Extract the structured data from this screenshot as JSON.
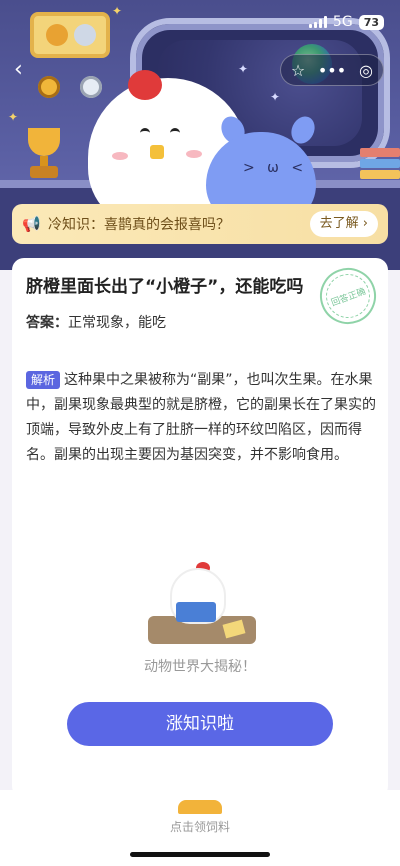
{
  "status_bar": {
    "network": "5G",
    "battery": "73"
  },
  "header": {
    "back_icon": "chevron-left-icon",
    "actions": [
      {
        "name": "favorite",
        "icon": "star-outline-icon"
      },
      {
        "name": "more",
        "icon": "more-dots-icon"
      },
      {
        "name": "close",
        "icon": "target-circle-icon"
      }
    ]
  },
  "tip": {
    "icon": "megaphone-icon",
    "text": "冷知识：喜鹊真的会报喜吗？",
    "button_label": "去了解 ›"
  },
  "question": {
    "title": "脐橙里面长出了“小橙子”，还能吃吗",
    "answer_label": "答案：",
    "answer_value": "正常现象，能吃",
    "stamp_text": "回答正确",
    "analysis_tag": "解析",
    "analysis_text": "这种果中之果被称为“副果”，也叫次生果。在水果中，副果现象最典型的就是脐橙，它的副果长在了果实的顶端，导致外皮上有了肚脐一样的环纹凹陷区，因而得名。副果的出现主要因为基因突变，并不影响食用。"
  },
  "illustration_caption": "动物世界大揭秘！",
  "cta_label": "涨知识啦",
  "bottom_bar": {
    "label": "点击领饲料"
  },
  "colors": {
    "accent": "#5a67e6",
    "tip_bg": "#fbe9b8",
    "hero_bg": "#4a4e8d"
  }
}
